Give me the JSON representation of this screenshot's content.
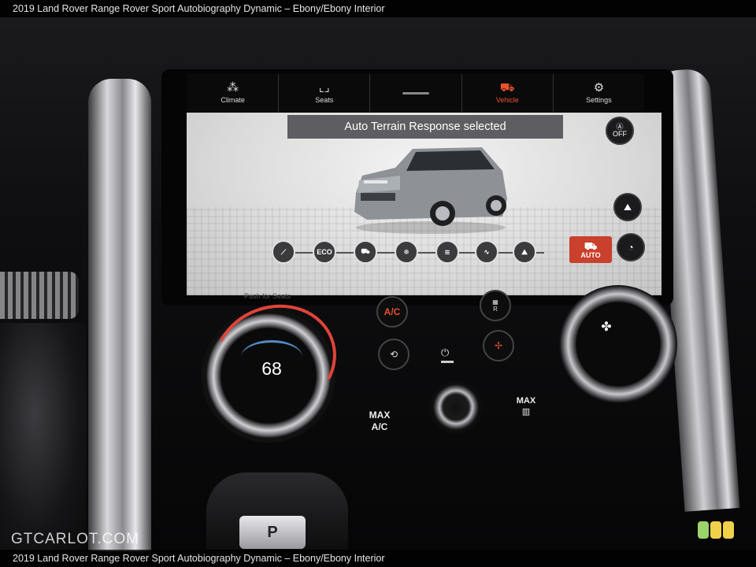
{
  "caption": {
    "top": "2019 Land Rover Range Rover Sport Autobiography Dynamic – Ebony/Ebony Interior",
    "bottom": "2019 Land Rover Range Rover Sport Autobiography Dynamic – Ebony/Ebony Interior"
  },
  "nav": {
    "items": [
      {
        "label": "Climate",
        "icon": "climate-icon"
      },
      {
        "label": "Seats",
        "icon": "seats-icon"
      },
      {
        "label": "",
        "icon": "home-dash-icon"
      },
      {
        "label": "Vehicle",
        "icon": "vehicle-icon",
        "active": true
      },
      {
        "label": "Settings",
        "icon": "settings-icon"
      }
    ],
    "active_color": "#e8522f"
  },
  "terrain": {
    "banner": "Auto Terrain Response selected",
    "off_button": "OFF",
    "modes": [
      {
        "name": "dynamic-mode",
        "label": "⟋"
      },
      {
        "name": "eco-mode",
        "label": "ECO"
      },
      {
        "name": "comfort-mode",
        "label": "⛟"
      },
      {
        "name": "grass-gravel-snow-mode",
        "label": "❄"
      },
      {
        "name": "mud-ruts-mode",
        "label": "≋"
      },
      {
        "name": "sand-mode",
        "label": "∿"
      },
      {
        "name": "rock-crawl-mode",
        "label": "⛰"
      }
    ],
    "auto_label": "AUTO",
    "auto_color": "#c9402c"
  },
  "climate": {
    "push_label": "Push for Seats",
    "temperature": "68",
    "ac_label": "A/C",
    "max_ac": "MAX A/C",
    "max_defrost": "MAX",
    "rear_label": "R",
    "accent": "#e0443a"
  },
  "gear": {
    "position": "P"
  },
  "watermark": "GTCARLOT.COM"
}
